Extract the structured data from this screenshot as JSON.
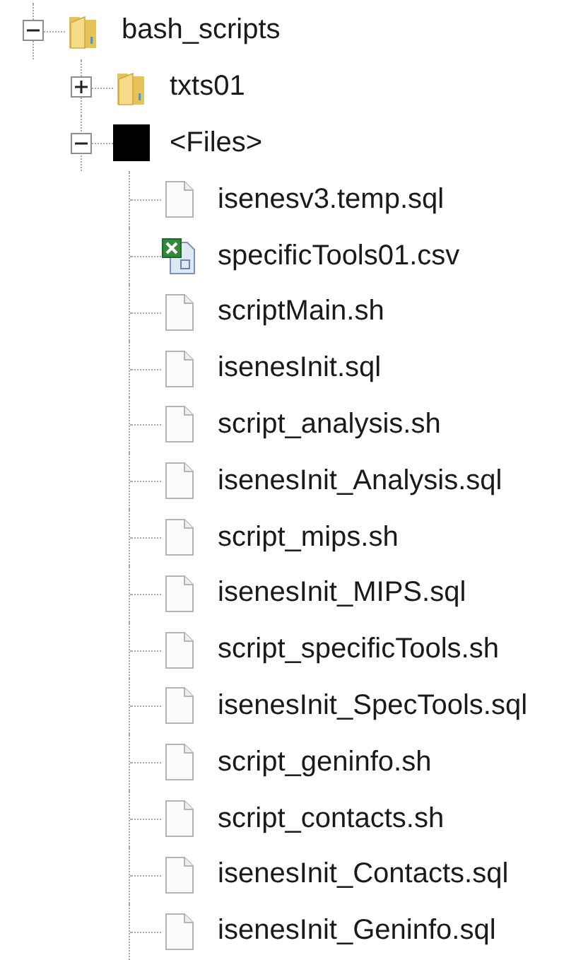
{
  "tree": [
    {
      "label": "bash_scripts",
      "kind": "folder",
      "expanded": true,
      "children": [
        {
          "label": "txts01",
          "kind": "folder",
          "expanded": false
        },
        {
          "label": "<Files>",
          "kind": "block",
          "expanded": true,
          "children": [
            {
              "label": "isenesv3.temp.sql",
              "kind": "file"
            },
            {
              "label": "specificTools01.csv",
              "kind": "spreadsheet"
            },
            {
              "label": "scriptMain.sh",
              "kind": "file"
            },
            {
              "label": "isenesInit.sql",
              "kind": "file"
            },
            {
              "label": "script_analysis.sh",
              "kind": "file"
            },
            {
              "label": "isenesInit_Analysis.sql",
              "kind": "file"
            },
            {
              "label": "script_mips.sh",
              "kind": "file"
            },
            {
              "label": "isenesInit_MIPS.sql",
              "kind": "file"
            },
            {
              "label": "script_specificTools.sh",
              "kind": "file"
            },
            {
              "label": "isenesInit_SpecTools.sql",
              "kind": "file"
            },
            {
              "label": "script_geninfo.sh",
              "kind": "file"
            },
            {
              "label": "script_contacts.sh",
              "kind": "file"
            },
            {
              "label": "isenesInit_Contacts.sql",
              "kind": "file"
            },
            {
              "label": "isenesInit_Geninfo.sql",
              "kind": "file"
            }
          ]
        }
      ]
    }
  ]
}
